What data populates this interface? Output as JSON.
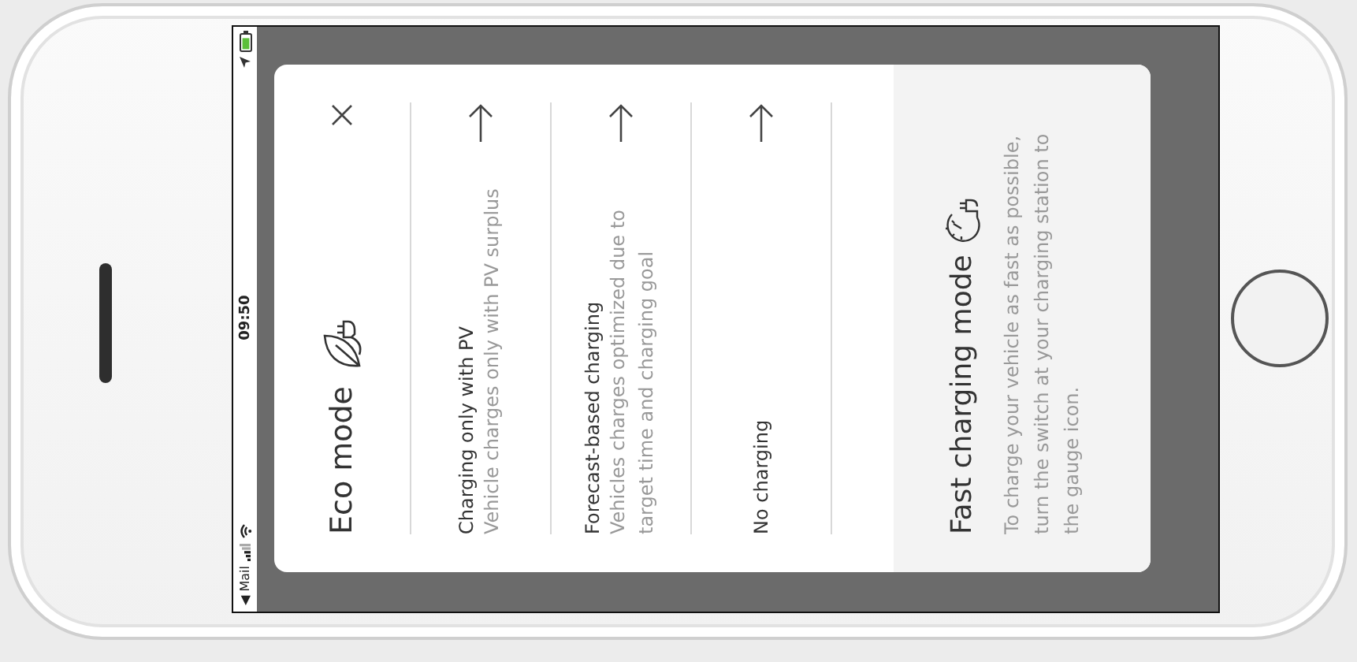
{
  "status_bar": {
    "back_label": "◀ Mail",
    "time": "09:50"
  },
  "dialog": {
    "title": "Eco mode",
    "options": [
      {
        "title": "Charging only with PV",
        "description": "Vehicle charges only with PV surplus"
      },
      {
        "title": "Forecast-based charging",
        "description": "Vehicles charges optimized due to target time and charging goal"
      },
      {
        "title": "No charging"
      }
    ],
    "info": {
      "title": "Fast charging mode",
      "text": "To charge your vehicle as fast as possible, turn the switch at your charging station to the gauge icon."
    }
  }
}
